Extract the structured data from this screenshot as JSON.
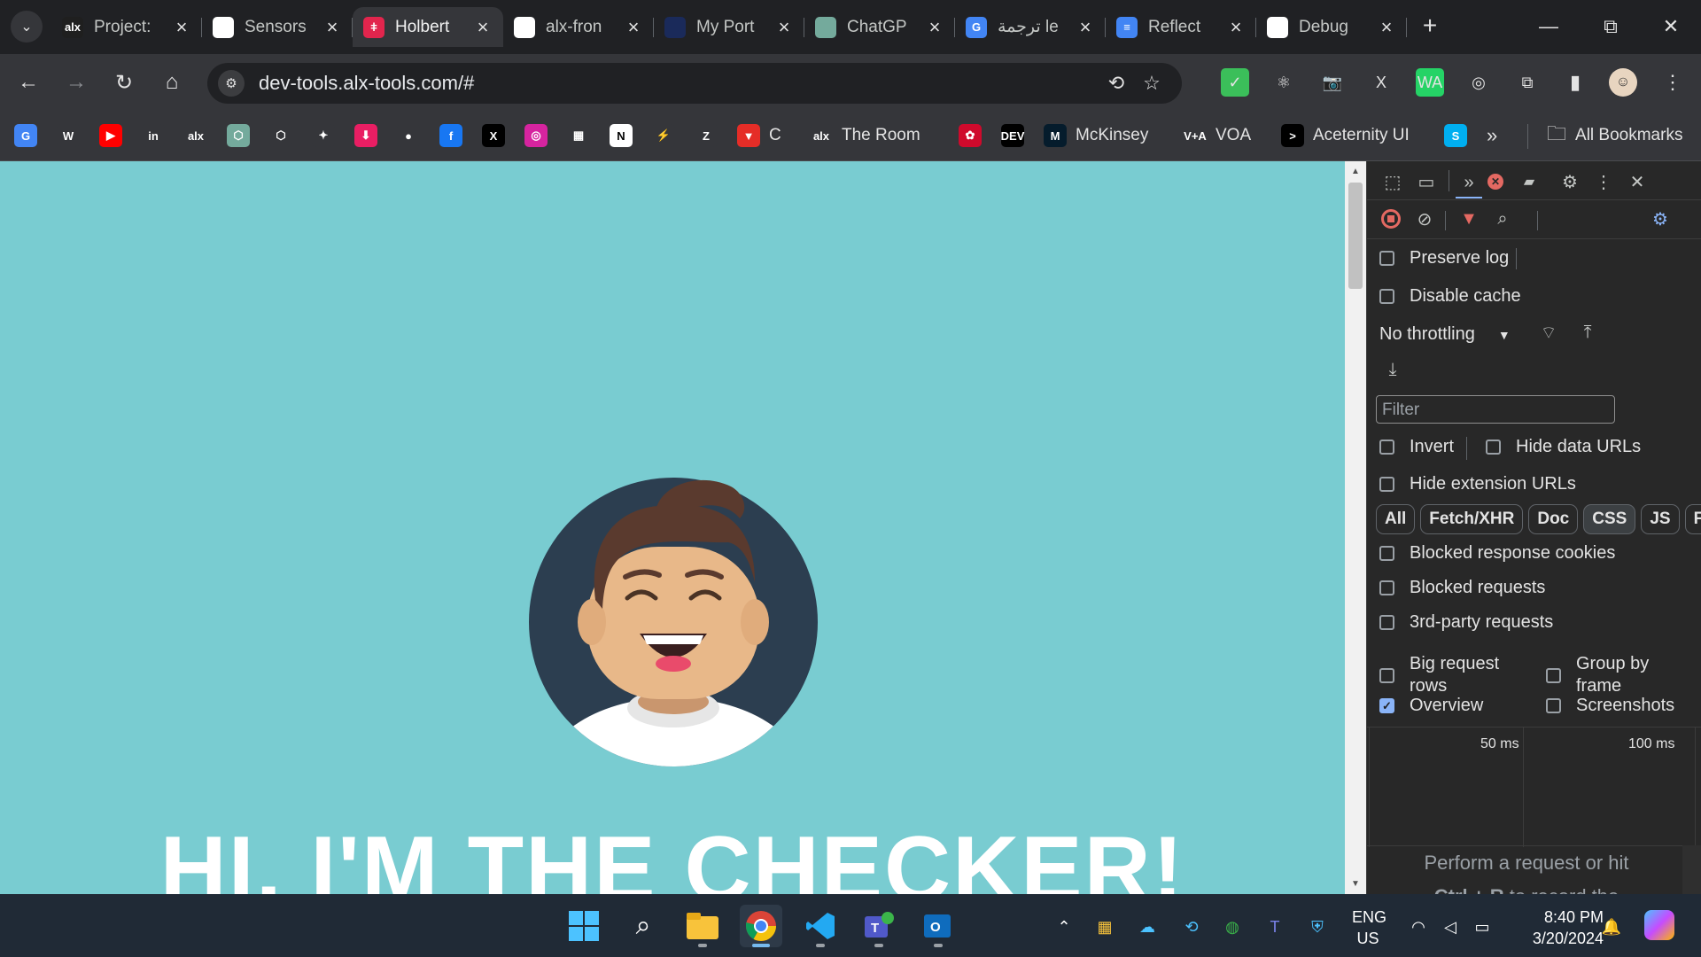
{
  "tabs": [
    {
      "title": "Project:",
      "icon": "alx-icon",
      "color": "#1f1f1f",
      "glyph": "alx",
      "active": false
    },
    {
      "title": "Sensors",
      "icon": "chrome-icon",
      "color": "#ffffff",
      "glyph": "",
      "active": false
    },
    {
      "title": "Holbert",
      "icon": "holberton-icon",
      "color": "#e2254d",
      "glyph": "ǂ",
      "active": true
    },
    {
      "title": "alx-fron",
      "icon": "github-icon",
      "color": "#ffffff",
      "glyph": "",
      "active": false
    },
    {
      "title": "My Port",
      "icon": "portfolio-icon",
      "color": "#1a2a5a",
      "glyph": "",
      "active": false
    },
    {
      "title": "ChatGP",
      "icon": "chatgpt-icon",
      "color": "#74aa9c",
      "glyph": "",
      "active": false
    },
    {
      "title": "ترجمة le",
      "icon": "google-translate-icon",
      "color": "#4285f4",
      "glyph": "G",
      "active": false
    },
    {
      "title": "Reflect",
      "icon": "google-docs-icon",
      "color": "#4285f4",
      "glyph": "≡",
      "active": false
    },
    {
      "title": "Debug",
      "icon": "debug-icon",
      "color": "#ffffff",
      "glyph": "",
      "active": false
    }
  ],
  "toolbar": {
    "url": "dev-tools.alx-tools.com/#"
  },
  "extensions": [
    {
      "name": "adguard-icon",
      "color": "#3bbf5a",
      "glyph": "✓"
    },
    {
      "name": "react-devtools-icon",
      "color": "#35363a",
      "glyph": "⚛"
    },
    {
      "name": "screenshot-icon",
      "color": "#35363a",
      "glyph": "📷"
    },
    {
      "name": "excel-icon",
      "color": "#35363a",
      "glyph": "X"
    },
    {
      "name": "whatsapp-icon",
      "color": "#25d366",
      "glyph": "WA"
    },
    {
      "name": "incognito-icon",
      "color": "#35363a",
      "glyph": "◎"
    },
    {
      "name": "extensions-puzzle-icon",
      "color": "#35363a",
      "glyph": "⧉"
    }
  ],
  "bookmarks": [
    {
      "label": "",
      "icon": "google-translate-icon",
      "color": "#4285f4",
      "glyph": "G"
    },
    {
      "label": "",
      "icon": "w-icon",
      "color": "#35363a",
      "glyph": "W"
    },
    {
      "label": "",
      "icon": "youtube-icon",
      "color": "#ff0000",
      "glyph": "▶"
    },
    {
      "label": "",
      "icon": "linkedin-icon",
      "color": "#35363a",
      "glyph": "in"
    },
    {
      "label": "",
      "icon": "alx-icon",
      "color": "#35363a",
      "glyph": "alx"
    },
    {
      "label": "",
      "icon": "chatgpt-icon",
      "color": "#74aa9c",
      "glyph": "⬡"
    },
    {
      "label": "",
      "icon": "openai-icon",
      "color": "#35363a",
      "glyph": "⬡"
    },
    {
      "label": "",
      "icon": "gemini-icon",
      "color": "#35363a",
      "glyph": "✦"
    },
    {
      "label": "",
      "icon": "download-icon",
      "color": "#e91e63",
      "glyph": "⬇"
    },
    {
      "label": "",
      "icon": "github-icon",
      "color": "#35363a",
      "glyph": "●"
    },
    {
      "label": "",
      "icon": "facebook-icon",
      "color": "#1877f2",
      "glyph": "f"
    },
    {
      "label": "",
      "icon": "x-icon",
      "color": "#000000",
      "glyph": "X"
    },
    {
      "label": "",
      "icon": "instagram-icon",
      "color": "#d6249f",
      "glyph": "◎"
    },
    {
      "label": "",
      "icon": "microsoft-icon",
      "color": "#35363a",
      "glyph": "▦"
    },
    {
      "label": "",
      "icon": "notion-icon",
      "color": "#ffffff",
      "glyph": "N"
    },
    {
      "label": "",
      "icon": "feather-icon",
      "color": "#35363a",
      "glyph": "⚡"
    },
    {
      "label": "",
      "icon": "z-icon",
      "color": "#35363a",
      "glyph": "Z"
    },
    {
      "label": "C",
      "icon": "c-icon",
      "color": "#e52d27",
      "glyph": "▼"
    },
    {
      "label": "The Room",
      "icon": "the-room-icon",
      "color": "#35363a",
      "glyph": "alx"
    },
    {
      "label": "",
      "icon": "huawei-icon",
      "color": "#cf0a2c",
      "glyph": "✿"
    },
    {
      "label": "",
      "icon": "dev-icon",
      "color": "#000000",
      "glyph": "DEV"
    },
    {
      "label": "McKinsey",
      "icon": "mckinsey-icon",
      "color": "#051c2c",
      "glyph": "M"
    },
    {
      "label": "VOA",
      "icon": "voa-icon",
      "color": "#35363a",
      "glyph": "V+A"
    },
    {
      "label": "Aceternity UI",
      "icon": "aceternity-icon",
      "color": "#000000",
      "glyph": ">"
    },
    {
      "label": "",
      "icon": "skype-icon",
      "color": "#00aff0",
      "glyph": "S"
    }
  ],
  "bookmarks_all": "All Bookmarks",
  "page": {
    "headline": "HI, I'M THE CHECKER!",
    "bg_color": "#79ccd1"
  },
  "devtools": {
    "preserve_log": "Preserve log",
    "disable_cache": "Disable cache",
    "throttling": "No throttling",
    "filter_placeholder": "Filter",
    "invert": "Invert",
    "hide_data_urls": "Hide data URLs",
    "hide_extension_urls": "Hide extension URLs",
    "types": [
      "All",
      "Fetch/XHR",
      "Doc",
      "CSS",
      "JS",
      "Fon"
    ],
    "selected_type": "CSS",
    "blocked_response_cookies": "Blocked response cookies",
    "blocked_requests": "Blocked requests",
    "third_party_requests": "3rd-party requests",
    "big_request_rows": "Big request rows",
    "group_by_frame": "Group by frame",
    "overview": "Overview",
    "overview_checked": true,
    "screenshots": "Screenshots",
    "tick_50": "50 ms",
    "tick_100": "100 ms",
    "hint_line1": "Perform a request or hit",
    "hint_line2_bold": "Ctrl + R",
    "hint_line2_rest": "to record the"
  },
  "taskbar": {
    "lang_line1": "ENG",
    "lang_line2": "US",
    "time": "8:40 PM",
    "date": "3/20/2024"
  }
}
